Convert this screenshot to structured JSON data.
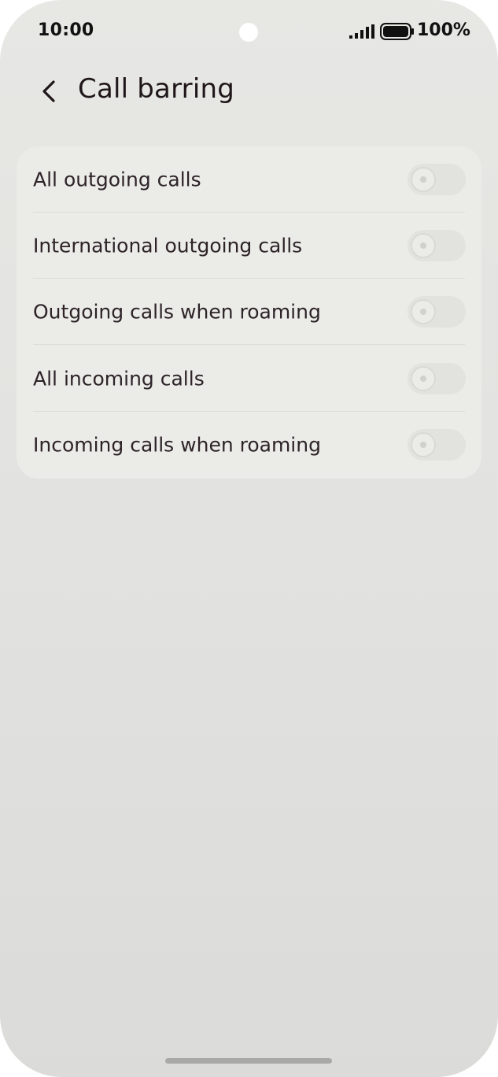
{
  "status_bar": {
    "time": "10:00",
    "battery": "100%",
    "icons": [
      "signal-icon",
      "battery-icon"
    ]
  },
  "header": {
    "back_icon": "chevron-left-icon",
    "title": "Call barring"
  },
  "settings": {
    "items": [
      {
        "label": "All outgoing calls",
        "enabled": false
      },
      {
        "label": "International outgoing calls",
        "enabled": false
      },
      {
        "label": "Outgoing calls when roaming",
        "enabled": false
      },
      {
        "label": "All incoming calls",
        "enabled": false
      },
      {
        "label": "Incoming calls when roaming",
        "enabled": false
      }
    ]
  },
  "colors": {
    "background": "#e4e4e1",
    "card": "#ebebe8",
    "text": "#2d2328",
    "toggle_track_off": "#e2e2df"
  }
}
